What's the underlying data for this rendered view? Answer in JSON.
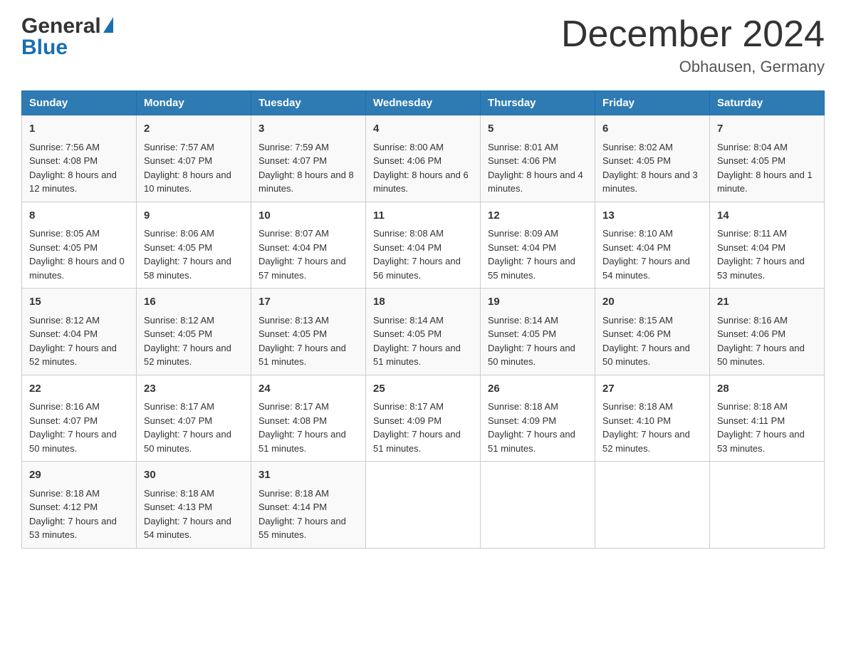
{
  "header": {
    "title": "December 2024",
    "location": "Obhausen, Germany"
  },
  "logo": {
    "general": "General",
    "blue": "Blue"
  },
  "days": [
    "Sunday",
    "Monday",
    "Tuesday",
    "Wednesday",
    "Thursday",
    "Friday",
    "Saturday"
  ],
  "weeks": [
    [
      {
        "num": "1",
        "sunrise": "7:56 AM",
        "sunset": "4:08 PM",
        "daylight": "8 hours and 12 minutes."
      },
      {
        "num": "2",
        "sunrise": "7:57 AM",
        "sunset": "4:07 PM",
        "daylight": "8 hours and 10 minutes."
      },
      {
        "num": "3",
        "sunrise": "7:59 AM",
        "sunset": "4:07 PM",
        "daylight": "8 hours and 8 minutes."
      },
      {
        "num": "4",
        "sunrise": "8:00 AM",
        "sunset": "4:06 PM",
        "daylight": "8 hours and 6 minutes."
      },
      {
        "num": "5",
        "sunrise": "8:01 AM",
        "sunset": "4:06 PM",
        "daylight": "8 hours and 4 minutes."
      },
      {
        "num": "6",
        "sunrise": "8:02 AM",
        "sunset": "4:05 PM",
        "daylight": "8 hours and 3 minutes."
      },
      {
        "num": "7",
        "sunrise": "8:04 AM",
        "sunset": "4:05 PM",
        "daylight": "8 hours and 1 minute."
      }
    ],
    [
      {
        "num": "8",
        "sunrise": "8:05 AM",
        "sunset": "4:05 PM",
        "daylight": "8 hours and 0 minutes."
      },
      {
        "num": "9",
        "sunrise": "8:06 AM",
        "sunset": "4:05 PM",
        "daylight": "7 hours and 58 minutes."
      },
      {
        "num": "10",
        "sunrise": "8:07 AM",
        "sunset": "4:04 PM",
        "daylight": "7 hours and 57 minutes."
      },
      {
        "num": "11",
        "sunrise": "8:08 AM",
        "sunset": "4:04 PM",
        "daylight": "7 hours and 56 minutes."
      },
      {
        "num": "12",
        "sunrise": "8:09 AM",
        "sunset": "4:04 PM",
        "daylight": "7 hours and 55 minutes."
      },
      {
        "num": "13",
        "sunrise": "8:10 AM",
        "sunset": "4:04 PM",
        "daylight": "7 hours and 54 minutes."
      },
      {
        "num": "14",
        "sunrise": "8:11 AM",
        "sunset": "4:04 PM",
        "daylight": "7 hours and 53 minutes."
      }
    ],
    [
      {
        "num": "15",
        "sunrise": "8:12 AM",
        "sunset": "4:04 PM",
        "daylight": "7 hours and 52 minutes."
      },
      {
        "num": "16",
        "sunrise": "8:12 AM",
        "sunset": "4:05 PM",
        "daylight": "7 hours and 52 minutes."
      },
      {
        "num": "17",
        "sunrise": "8:13 AM",
        "sunset": "4:05 PM",
        "daylight": "7 hours and 51 minutes."
      },
      {
        "num": "18",
        "sunrise": "8:14 AM",
        "sunset": "4:05 PM",
        "daylight": "7 hours and 51 minutes."
      },
      {
        "num": "19",
        "sunrise": "8:14 AM",
        "sunset": "4:05 PM",
        "daylight": "7 hours and 50 minutes."
      },
      {
        "num": "20",
        "sunrise": "8:15 AM",
        "sunset": "4:06 PM",
        "daylight": "7 hours and 50 minutes."
      },
      {
        "num": "21",
        "sunrise": "8:16 AM",
        "sunset": "4:06 PM",
        "daylight": "7 hours and 50 minutes."
      }
    ],
    [
      {
        "num": "22",
        "sunrise": "8:16 AM",
        "sunset": "4:07 PM",
        "daylight": "7 hours and 50 minutes."
      },
      {
        "num": "23",
        "sunrise": "8:17 AM",
        "sunset": "4:07 PM",
        "daylight": "7 hours and 50 minutes."
      },
      {
        "num": "24",
        "sunrise": "8:17 AM",
        "sunset": "4:08 PM",
        "daylight": "7 hours and 51 minutes."
      },
      {
        "num": "25",
        "sunrise": "8:17 AM",
        "sunset": "4:09 PM",
        "daylight": "7 hours and 51 minutes."
      },
      {
        "num": "26",
        "sunrise": "8:18 AM",
        "sunset": "4:09 PM",
        "daylight": "7 hours and 51 minutes."
      },
      {
        "num": "27",
        "sunrise": "8:18 AM",
        "sunset": "4:10 PM",
        "daylight": "7 hours and 52 minutes."
      },
      {
        "num": "28",
        "sunrise": "8:18 AM",
        "sunset": "4:11 PM",
        "daylight": "7 hours and 53 minutes."
      }
    ],
    [
      {
        "num": "29",
        "sunrise": "8:18 AM",
        "sunset": "4:12 PM",
        "daylight": "7 hours and 53 minutes."
      },
      {
        "num": "30",
        "sunrise": "8:18 AM",
        "sunset": "4:13 PM",
        "daylight": "7 hours and 54 minutes."
      },
      {
        "num": "31",
        "sunrise": "8:18 AM",
        "sunset": "4:14 PM",
        "daylight": "7 hours and 55 minutes."
      },
      null,
      null,
      null,
      null
    ]
  ]
}
